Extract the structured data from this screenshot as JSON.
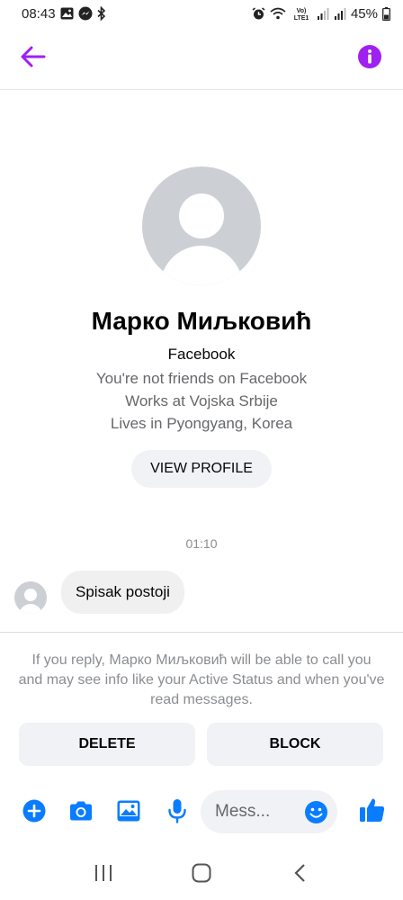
{
  "status_bar": {
    "time": "08:43",
    "left_icons": [
      "gallery-icon",
      "messenger-icon",
      "bluetooth-icon"
    ],
    "right_icons": [
      "alarm-icon",
      "wifi-icon",
      "volte-icon",
      "signal-icon",
      "signal-icon"
    ],
    "volte_label": "Vo) LTE1",
    "battery": "45%"
  },
  "header": {
    "back_icon": "arrow-left-icon",
    "info_icon": "info-icon",
    "accent_color": "#a020f0"
  },
  "profile": {
    "name": "Марко Миљковић",
    "platform": "Facebook",
    "details": [
      "You're not friends on Facebook",
      "Works at Vojska Srbije",
      "Lives in Pyongyang, Korea"
    ],
    "view_profile_label": "VIEW PROFILE"
  },
  "conversation": {
    "timestamp": "01:10",
    "messages": [
      {
        "text": "Spisak postoji"
      }
    ]
  },
  "request": {
    "notice": "If you reply, Марко Миљковић will be able to call you and may see info like your Active Status and when you've read messages.",
    "delete_label": "DELETE",
    "block_label": "BLOCK"
  },
  "composer": {
    "placeholder": "Mess...",
    "icons": [
      "plus-icon",
      "camera-icon",
      "image-icon",
      "microphone-icon",
      "emoji-icon",
      "thumbs-up-icon"
    ],
    "accent_color": "#0a7cff"
  },
  "nav_bar": {
    "icons": [
      "recent-apps-icon",
      "home-icon",
      "back-icon"
    ]
  }
}
